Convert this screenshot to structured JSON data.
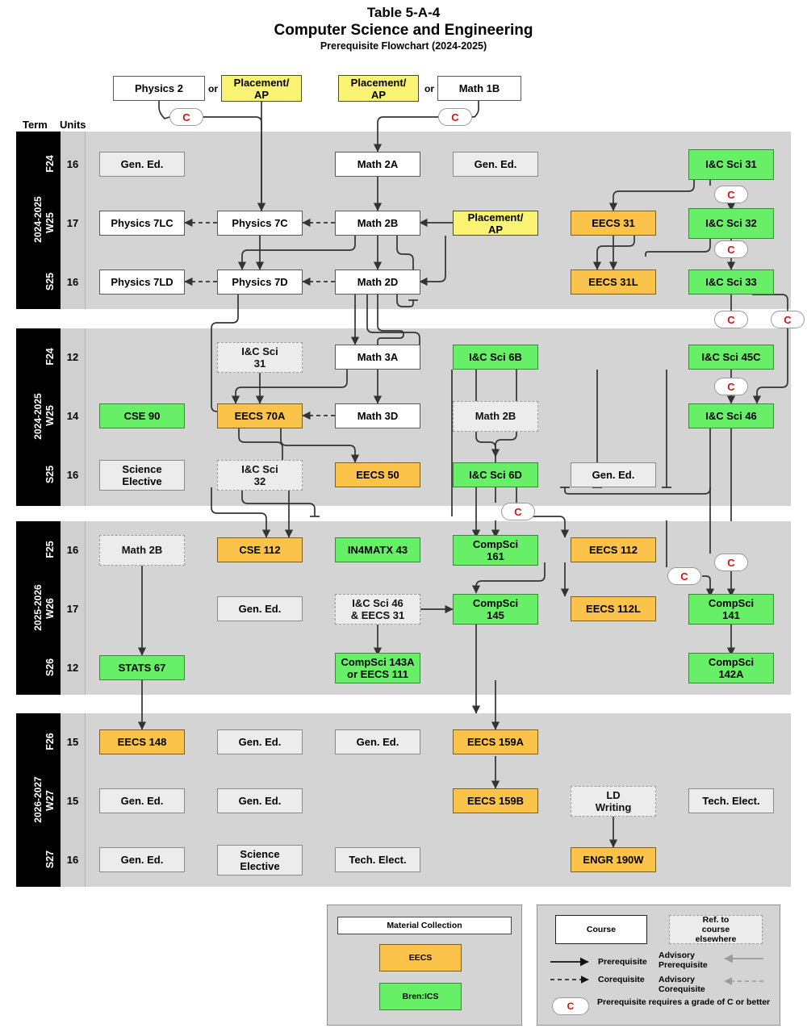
{
  "title": {
    "line1": "Table 5-A-4",
    "line2": "Computer Science and Engineering",
    "line3": "Prerequisite Flowchart (2024-2025)"
  },
  "headers": {
    "term": "Term",
    "units": "Units"
  },
  "colors": {
    "eecs": "#fbc34a",
    "brenics": "#68ef68",
    "placement": "#fbf373",
    "gened": "#ececec",
    "course": "#ffffff",
    "block_bg": "#d4d4d4",
    "term_bg": "#000000",
    "grade_c": "#d01414"
  },
  "top_row": {
    "boxes": [
      {
        "label": "Physics 2",
        "style": "white"
      },
      {
        "label": "or",
        "style": "text"
      },
      {
        "label": "Placement/ AP",
        "style": "yellow"
      },
      {
        "label": "Placement/ AP",
        "style": "yellow"
      },
      {
        "label": "or",
        "style": "text"
      },
      {
        "label": "Math 1B",
        "style": "white"
      }
    ],
    "grade_pills": [
      "C",
      "C"
    ]
  },
  "blocks": [
    {
      "year": "2024-2025",
      "rows": [
        {
          "term": "F24",
          "units": "16",
          "nodes": [
            {
              "label": "Gen. Ed.",
              "style": "gray",
              "col": 0
            },
            {
              "label": "Math 2A",
              "style": "white",
              "col": 2
            },
            {
              "label": "Gen. Ed.",
              "style": "gray",
              "col": 3
            },
            {
              "label": "I&C Sci 31",
              "style": "green",
              "col": 5
            }
          ]
        },
        {
          "term": "W25",
          "units": "17",
          "nodes": [
            {
              "label": "Physics 7LC",
              "style": "white",
              "col": 0
            },
            {
              "label": "Physics 7C",
              "style": "white",
              "col": 1
            },
            {
              "label": "Math 2B",
              "style": "white",
              "col": 2
            },
            {
              "label": "Placement/ AP",
              "style": "yellow",
              "col": 3
            },
            {
              "label": "EECS 31",
              "style": "orange",
              "col": 4
            },
            {
              "label": "I&C Sci 32",
              "style": "green",
              "col": 5
            }
          ]
        },
        {
          "term": "S25",
          "units": "16",
          "nodes": [
            {
              "label": "Physics 7LD",
              "style": "white",
              "col": 0
            },
            {
              "label": "Physics 7D",
              "style": "white",
              "col": 1
            },
            {
              "label": "Math 2D",
              "style": "white",
              "col": 2
            },
            {
              "label": "EECS 31L",
              "style": "orange",
              "col": 4
            },
            {
              "label": "I&C Sci 33",
              "style": "green",
              "col": 5
            }
          ]
        }
      ]
    },
    {
      "year": "2024-2025",
      "rows": [
        {
          "term": "F24",
          "units": "12",
          "nodes": [
            {
              "label": "I&C Sci 31",
              "style": "dashed",
              "col": 1
            },
            {
              "label": "Math 3A",
              "style": "white",
              "col": 2
            },
            {
              "label": "I&C Sci 6B",
              "style": "green",
              "col": 3
            },
            {
              "label": "I&C Sci 45C",
              "style": "green",
              "col": 5
            }
          ]
        },
        {
          "term": "W25",
          "units": "14",
          "nodes": [
            {
              "label": "CSE 90",
              "style": "green",
              "col": 0
            },
            {
              "label": "EECS 70A",
              "style": "orange",
              "col": 1
            },
            {
              "label": "Math 3D",
              "style": "white",
              "col": 2
            },
            {
              "label": "Math 2B",
              "style": "dashed",
              "col": 3
            },
            {
              "label": "I&C Sci 46",
              "style": "green",
              "col": 5
            }
          ]
        },
        {
          "term": "S25",
          "units": "16",
          "nodes": [
            {
              "label": "Science Elective",
              "style": "gray",
              "col": 0
            },
            {
              "label": "I&C Sci 32",
              "style": "dashed",
              "col": 1
            },
            {
              "label": "EECS 50",
              "style": "orange",
              "col": 2
            },
            {
              "label": "I&C Sci 6D",
              "style": "green",
              "col": 3
            },
            {
              "label": "Gen. Ed.",
              "style": "gray",
              "col": 4
            }
          ]
        }
      ]
    },
    {
      "year": "2025-2026",
      "rows": [
        {
          "term": "F25",
          "units": "16",
          "nodes": [
            {
              "label": "Math 2B",
              "style": "dashed",
              "col": 0
            },
            {
              "label": "CSE 112",
              "style": "orange",
              "col": 1
            },
            {
              "label": "IN4MATX 43",
              "style": "green",
              "col": 2
            },
            {
              "label": "CompSci 161",
              "style": "green",
              "col": 3
            },
            {
              "label": "EECS 112",
              "style": "orange",
              "col": 4
            },
            {
              "label": "CompSci 141",
              "style": "green",
              "col": 5,
              "rowspan_offset": 1
            }
          ]
        },
        {
          "term": "W26",
          "units": "17",
          "nodes": [
            {
              "label": "Gen. Ed.",
              "style": "gray",
              "col": 1
            },
            {
              "label": "I&C Sci 46 & EECS 31",
              "style": "dashed",
              "col": 2
            },
            {
              "label": "CompSci 145",
              "style": "green",
              "col": 3
            },
            {
              "label": "EECS 112L",
              "style": "orange",
              "col": 4
            },
            {
              "label": "CompSci 141",
              "style": "green",
              "col": 5
            }
          ]
        },
        {
          "term": "S26",
          "units": "12",
          "nodes": [
            {
              "label": "STATS 67",
              "style": "green",
              "col": 0
            },
            {
              "label": "CompSci 143A or EECS 111",
              "style": "green",
              "col": 2
            },
            {
              "label": "CompSci 142A",
              "style": "green",
              "col": 5
            }
          ]
        }
      ]
    },
    {
      "year": "2026-2027",
      "rows": [
        {
          "term": "F26",
          "units": "15",
          "nodes": [
            {
              "label": "EECS 148",
              "style": "orange",
              "col": 0
            },
            {
              "label": "Gen. Ed.",
              "style": "gray",
              "col": 1
            },
            {
              "label": "Gen. Ed.",
              "style": "gray",
              "col": 2
            },
            {
              "label": "EECS 159A",
              "style": "orange",
              "col": 3
            }
          ]
        },
        {
          "term": "W27",
          "units": "15",
          "nodes": [
            {
              "label": "Gen. Ed.",
              "style": "gray",
              "col": 0
            },
            {
              "label": "Gen. Ed.",
              "style": "gray",
              "col": 1
            },
            {
              "label": "EECS 159B",
              "style": "orange",
              "col": 3
            },
            {
              "label": "LD Writing",
              "style": "dashed",
              "col": 4
            },
            {
              "label": "Tech. Elect.",
              "style": "gray",
              "col": 5
            }
          ]
        },
        {
          "term": "S27",
          "units": "16",
          "nodes": [
            {
              "label": "Gen. Ed.",
              "style": "gray",
              "col": 0
            },
            {
              "label": "Science Elective",
              "style": "gray",
              "col": 1
            },
            {
              "label": "Tech. Elect.",
              "style": "gray",
              "col": 2
            },
            {
              "label": "ENGR 190W",
              "style": "orange",
              "col": 4
            }
          ]
        }
      ]
    }
  ],
  "legend_left": {
    "items": [
      {
        "label": "Material Collection",
        "style": "white"
      },
      {
        "label": "EECS",
        "style": "orange"
      },
      {
        "label": "Bren:ICS",
        "style": "green"
      }
    ]
  },
  "legend_right": {
    "course_label": "Course",
    "ref_label": "Ref. to course elsewhere",
    "prerequisite": "Prerequisite",
    "corequisite": "Corequisite",
    "advisory_prerequisite": "Advisory Prerequisite",
    "advisory_corequisite": "Advisory Corequisite",
    "grade_pill": "C",
    "grade_note": "Prerequisite requires a grade of C or better"
  }
}
